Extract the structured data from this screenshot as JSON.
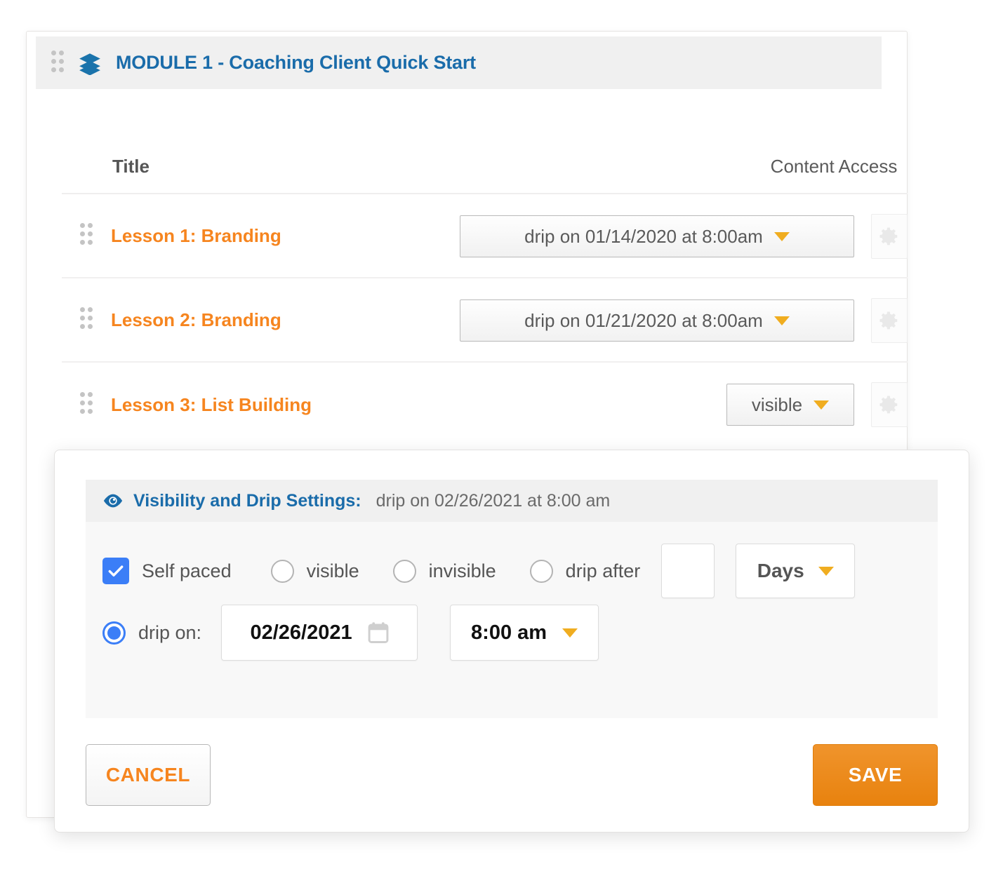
{
  "module": {
    "icon": "layers-icon",
    "drag_handle": "drag-handle-icon",
    "title": "MODULE 1 - Coaching Client Quick Start",
    "title_color": "#1a6caa"
  },
  "table": {
    "columns": {
      "title": "Title",
      "content_access": "Content Access"
    },
    "rows": [
      {
        "title": "Lesson 1: Branding",
        "access_value": "drip on 01/14/2020 at 8:00am",
        "access_width": "wide",
        "gear": "gear-icon"
      },
      {
        "title": "Lesson 2: Branding",
        "access_value": "drip on 01/21/2020 at 8:00am",
        "access_width": "wide",
        "gear": "gear-icon"
      },
      {
        "title": "Lesson 3: List Building",
        "access_value": "visible",
        "access_width": "narrow",
        "gear": "gear-icon"
      }
    ],
    "title_color": "#f6851f"
  },
  "modal": {
    "panel": {
      "icon": "eye-icon",
      "title": "Visibility and Drip Settings:",
      "subtitle": "drip on 02/26/2021 at 8:00 am"
    },
    "options": {
      "self_paced": {
        "label": "Self paced",
        "checked": true
      },
      "visible": {
        "label": "visible",
        "selected": false
      },
      "invisible": {
        "label": "invisible",
        "selected": false
      },
      "drip_after": {
        "label": "drip after",
        "selected": false
      },
      "drip_after_amount": "",
      "drip_after_amount_placeholder": "",
      "drip_after_unit": "Days"
    },
    "drip_on": {
      "label": "drip on:",
      "selected": true,
      "date": "02/26/2021",
      "calendar_icon": "calendar-icon",
      "time": "8:00 am"
    },
    "buttons": {
      "cancel": "CANCEL",
      "save": "SAVE"
    }
  },
  "colors": {
    "brand_blue": "#1a6caa",
    "accent_orange": "#f6851f",
    "caret_amber": "#f0ad20",
    "control_blue": "#3b7ef7"
  }
}
